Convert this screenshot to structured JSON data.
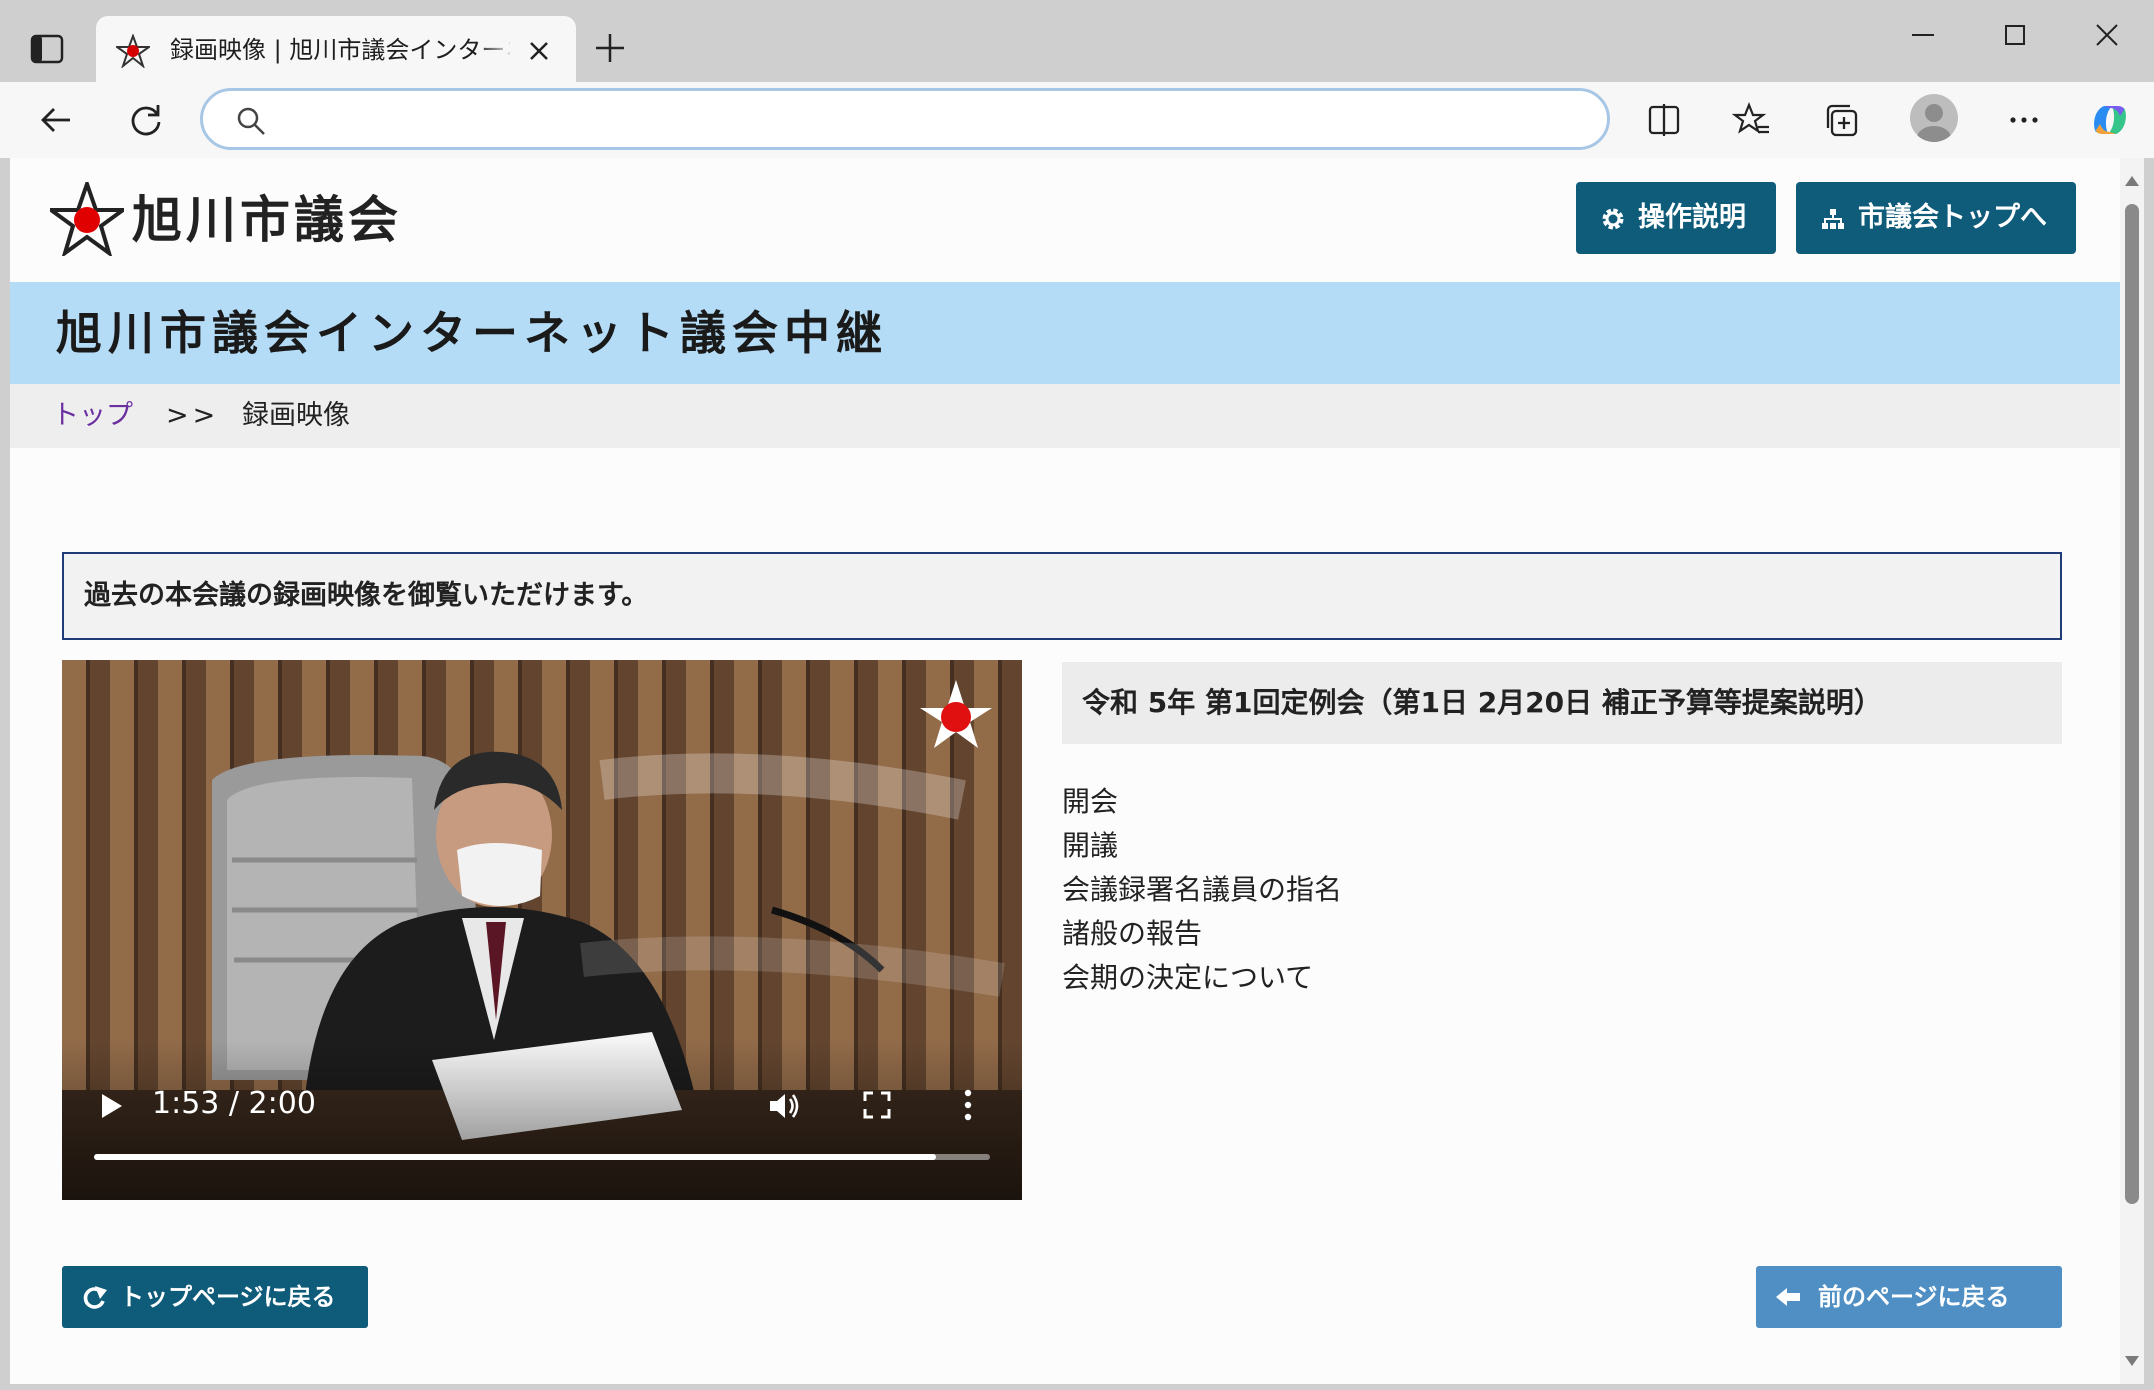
{
  "browser": {
    "tab_title": "録画映像 | 旭川市議会インターネット議会中継",
    "address_value": ""
  },
  "site": {
    "logo_text": "旭川市議会",
    "help_button": "操作説明",
    "top_button": "市議会トップへ",
    "banner_title": "旭川市議会インターネット議会中継",
    "brand_color": "#0e5b7a",
    "banner_color": "#b5dcf6"
  },
  "breadcrumb": {
    "home": "トップ",
    "separator": ">>",
    "current": "録画映像"
  },
  "notice": "過去の本会議の録画映像を御覧いただけます。",
  "video": {
    "current_time": "1:53",
    "duration": "2:00",
    "time_display": "1:53 / 2:00",
    "progress": 0.94
  },
  "session": {
    "title": "令和 5年 第1回定例会（第1日 2月20日 補正予算等提案説明）",
    "agenda": [
      "開会",
      "開議",
      "会議録署名議員の指名",
      "諸般の報告",
      "会期の決定について"
    ]
  },
  "nav": {
    "back_to_top": "トップページに戻る",
    "previous_page": "前のページに戻る"
  }
}
